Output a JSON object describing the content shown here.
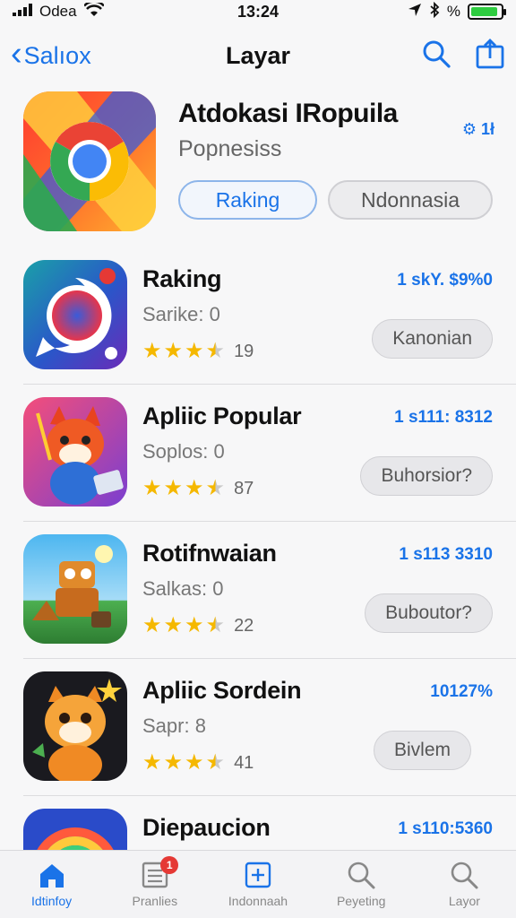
{
  "status": {
    "carrier": "Odea",
    "time": "13:24",
    "battery_text": "%",
    "battery_level": 0.9
  },
  "nav": {
    "back_label": "Salıox",
    "title": "Layar"
  },
  "hero": {
    "title": "Atdokasi IRopuila",
    "subtitle": "Popnesiss",
    "count": "1ł",
    "primary_button": "Raking",
    "secondary_button": "Ndonnasia"
  },
  "apps": [
    {
      "title": "Raking",
      "subtitle": "Sarike: 0",
      "rating": 3.5,
      "rating_count": "19",
      "price": "1 ѕkY. $9%0",
      "button": "Kanonian",
      "icon": "camera-lens-icon"
    },
    {
      "title": "Apliic Popular",
      "subtitle": "Soplos: 0",
      "rating": 3.5,
      "rating_count": "87",
      "price": "1 ѕ111: 8312",
      "button": "Buhorsior?",
      "icon": "fox-game-icon"
    },
    {
      "title": "Rotifnwaian",
      "subtitle": "Salkas: 0",
      "rating": 3.5,
      "rating_count": "22",
      "price": "1 ѕ113 3310",
      "button": "Buboutor?",
      "icon": "robot-game-icon"
    },
    {
      "title": "Apliic Sordein",
      "subtitle": "Sapr: 8",
      "rating": 3.5,
      "rating_count": "41",
      "price": "10127%",
      "button": "Bivlem",
      "icon": "tiger-cub-icon"
    },
    {
      "title": "Diepaucion",
      "subtitle": "",
      "rating": 0,
      "rating_count": "",
      "price": "1 ѕ110:5360",
      "button": "",
      "icon": "rainbow-icon"
    }
  ],
  "tabs": [
    {
      "label": "Idtinfoy",
      "icon": "home-icon",
      "active": true
    },
    {
      "label": "Pranlies",
      "icon": "list-icon",
      "badge": "1"
    },
    {
      "label": "Indonnaah",
      "icon": "star-add-icon"
    },
    {
      "label": "Peyeting",
      "icon": "search-icon"
    },
    {
      "label": "Layor",
      "icon": "search-icon"
    }
  ],
  "colors": {
    "accent": "#1a73e8",
    "star": "#f5b800",
    "badge": "#e53935"
  }
}
